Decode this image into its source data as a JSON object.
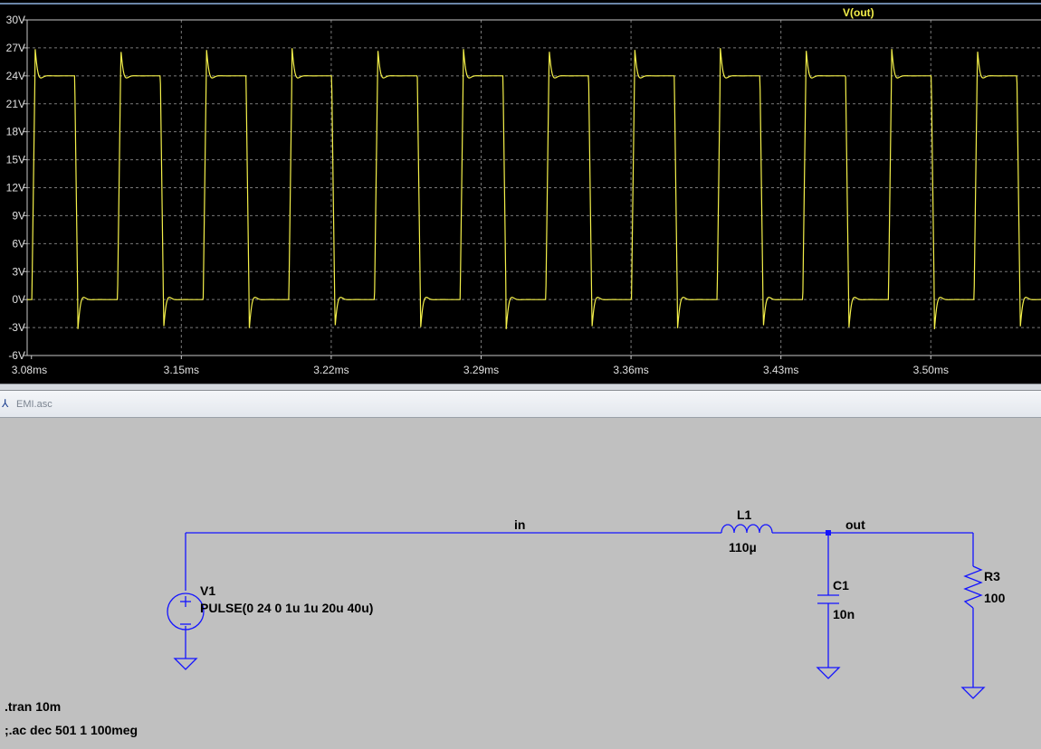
{
  "waveform": {
    "trace_label": "V(out)",
    "trace_color": "#f4f04a",
    "background": "#000000",
    "grid": true
  },
  "chart_data": {
    "type": "line",
    "title": "",
    "xlabel": "",
    "ylabel": "",
    "xlim": [
      3.078,
      3.5523
    ],
    "ylim": [
      -6,
      30
    ],
    "x_ticks": [
      "3.08ms",
      "3.15ms",
      "3.22ms",
      "3.29ms",
      "3.36ms",
      "3.43ms",
      "3.50ms"
    ],
    "y_ticks": [
      "30V",
      "27V",
      "24V",
      "21V",
      "18V",
      "15V",
      "12V",
      "9V",
      "6V",
      "3V",
      "0V",
      "-3V",
      "-6V"
    ],
    "series": [
      {
        "name": "V(out)",
        "period_ms": 0.04,
        "first_rise_ms": 3.0802,
        "high_level_V": 24,
        "low_level_V": 0,
        "overshoot_peak_V": 27,
        "undershoot_peak_V": -3.2
      }
    ]
  },
  "tab": {
    "title": "EMI.asc"
  },
  "schematic": {
    "wire_color": "#1414ff",
    "nets": {
      "in": "in",
      "out": "out"
    },
    "v1": {
      "name": "V1",
      "value": "PULSE(0 24 0 1u 1u 20u 40u)"
    },
    "l1": {
      "name": "L1",
      "value": "110µ"
    },
    "c1": {
      "name": "C1",
      "value": "10n"
    },
    "r3": {
      "name": "R3",
      "value": "100"
    },
    "directives": [
      ".tran 10m",
      ";.ac dec 501 1 100meg"
    ]
  }
}
